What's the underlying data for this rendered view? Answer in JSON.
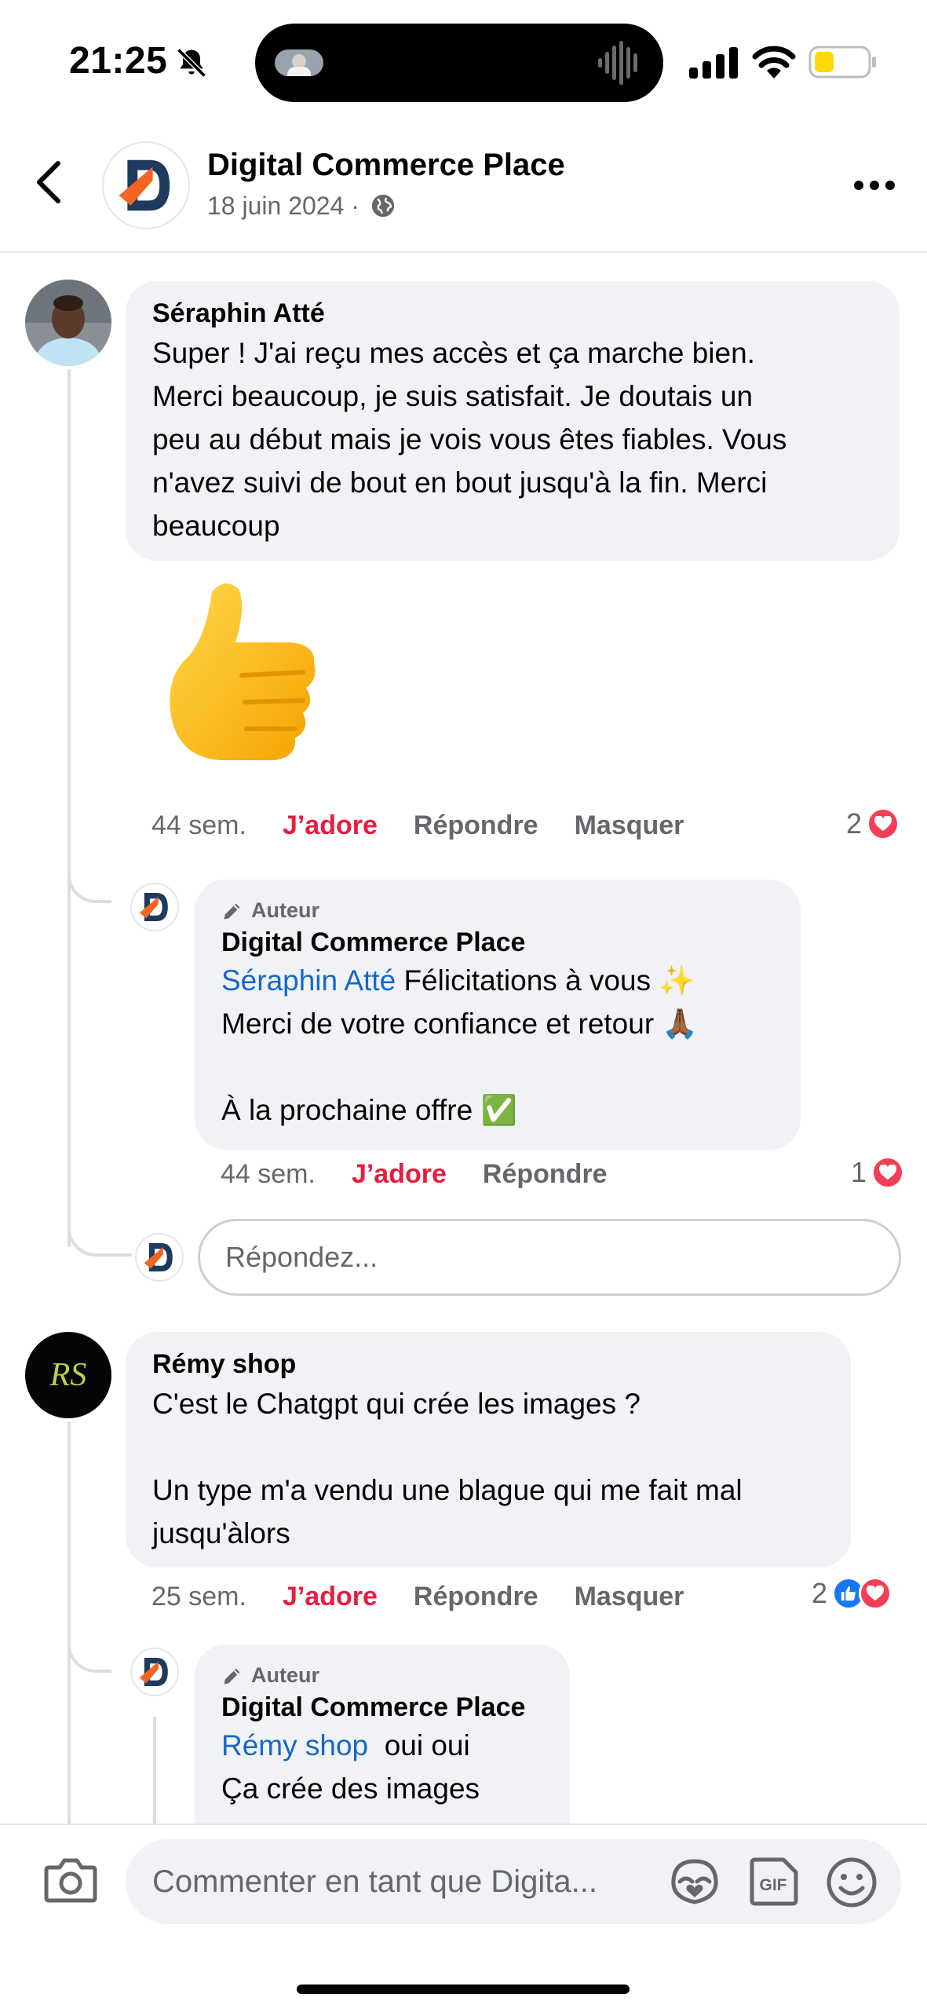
{
  "status_bar": {
    "time": "21:25"
  },
  "header": {
    "page_name": "Digital Commerce Place",
    "date": "18 juin 2024 ·"
  },
  "comments": [
    {
      "author": "Séraphin Atté",
      "text": "Super ! J'ai reçu mes accès et ça marche bien.\nMerci beaucoup, je suis satisfait. Je doutais un\npeu au début mais je vois vous êtes fiables. Vous\nn'avez suivi de bout en bout jusqu'à la fin. Merci\nbeaucoup",
      "sticker": "👍",
      "time": "44 sem.",
      "love": "J’adore",
      "reply": "Répondre",
      "hide": "Masquer",
      "reaction_count": "2",
      "replies": [
        {
          "badge": "Auteur",
          "author": "Digital Commerce Place",
          "mention": "Séraphin Atté",
          "text_first": " Félicitations à vous ✨",
          "text_rest": "Merci de votre confiance et retour 🙏🏾\n\nÀ la prochaine offre ✅",
          "time": "44 sem.",
          "love": "J’adore",
          "reply": "Répondre",
          "reaction_count": "1"
        }
      ],
      "reply_placeholder": "Répondez..."
    },
    {
      "author": "Rémy shop",
      "avatar_initials": "RS",
      "text": "C'est le Chatgpt qui crée les images ?\n\nUn type m'a vendu une blague qui me fait mal\njusqu'àlors",
      "time": "25 sem.",
      "love": "J’adore",
      "reply": "Répondre",
      "hide": "Masquer",
      "reaction_count": "2",
      "replies": [
        {
          "badge": "Auteur",
          "author": "Digital Commerce Place",
          "mention": "Rémy shop",
          "text_first": "  oui oui",
          "text_rest": "Ça crée des images"
        }
      ]
    }
  ],
  "composer": {
    "placeholder": "Commenter en tant que Digita..."
  },
  "colors": {
    "love": "#e41e3f",
    "mention": "#1668c7",
    "like": "#1877f2",
    "heart": "#f33e58",
    "brand_orange": "#f26522",
    "brand_navy": "#1e3a5f"
  }
}
